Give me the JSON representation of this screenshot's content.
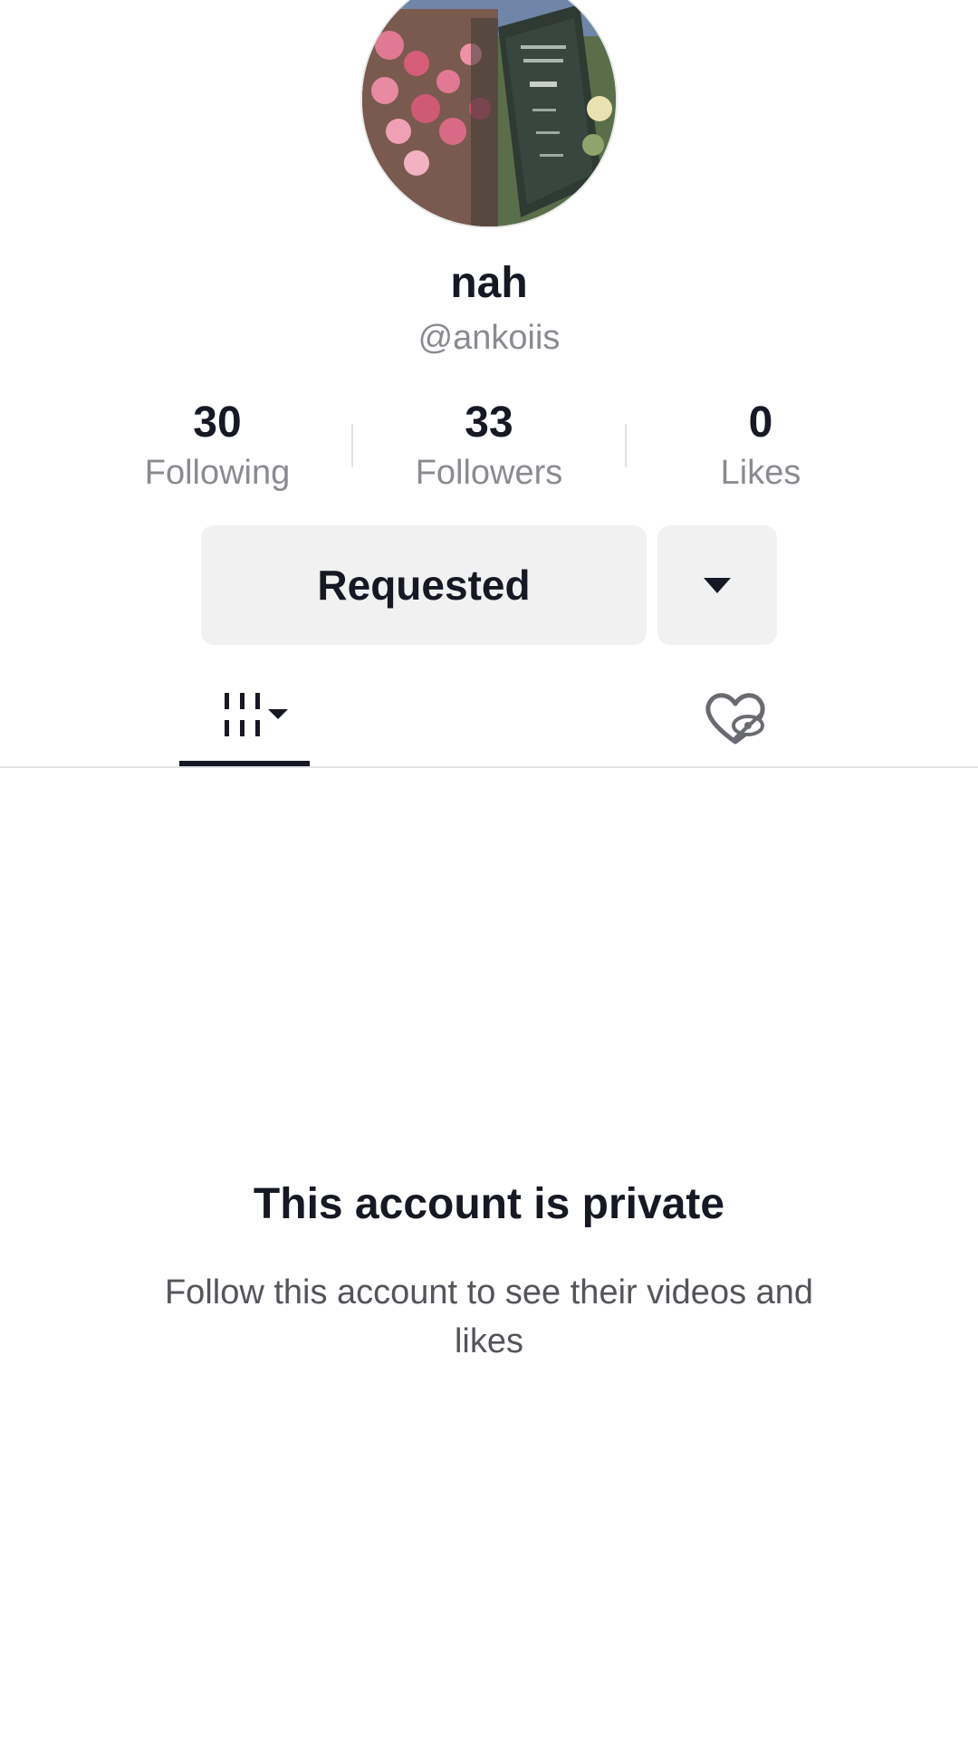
{
  "profile": {
    "display_name": "nah",
    "username": "@ankoiis",
    "avatar": "flower-stand-photo"
  },
  "stats": [
    {
      "value": "30",
      "label": "Following"
    },
    {
      "value": "33",
      "label": "Followers"
    },
    {
      "value": "0",
      "label": "Likes"
    }
  ],
  "actions": {
    "follow_status_label": "Requested",
    "more_icon": "caret-down-icon"
  },
  "tabs": {
    "videos_icon": "grid-icon",
    "liked_icon": "hidden-heart-icon",
    "active": "videos"
  },
  "private_notice": {
    "title": "This account is private",
    "description": "Follow this account to see their videos and likes"
  },
  "colors": {
    "text_primary": "#161823",
    "text_secondary": "#8a8b91",
    "button_bg": "#f1f1f2",
    "divider": "#e3e3e6"
  }
}
